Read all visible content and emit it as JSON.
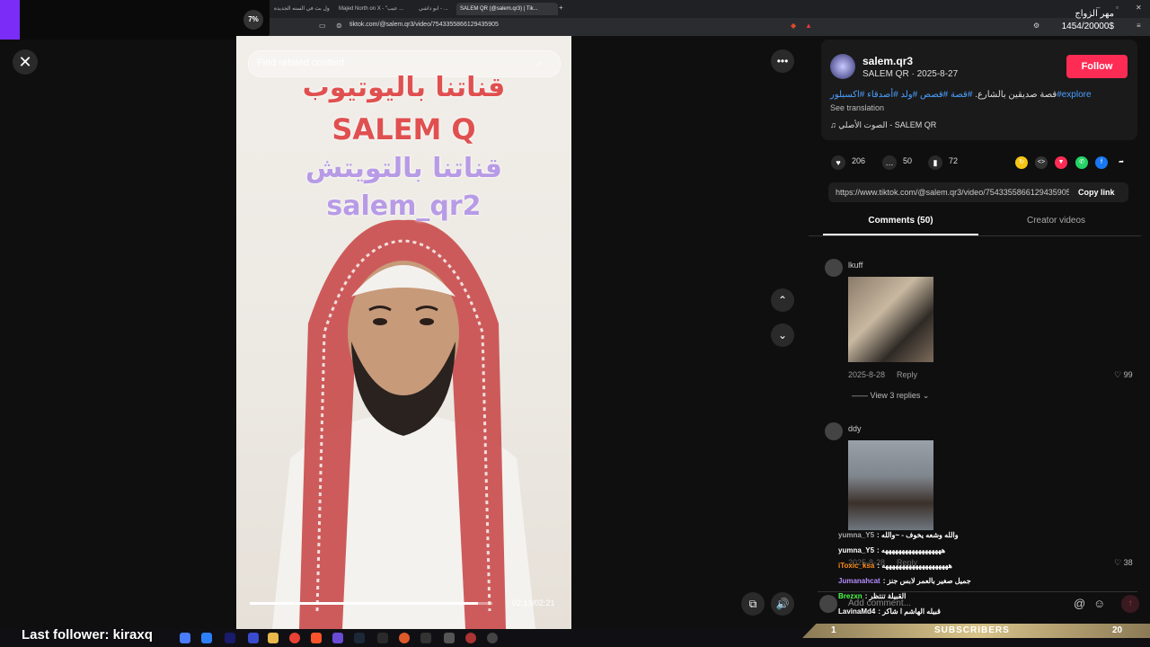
{
  "browser": {
    "tabs": [
      {
        "label": "اول بث في السنه الجديدة"
      },
      {
        "label": "Majed North on X - \"عيب ..."
      },
      {
        "label": "ابو داشي - ..."
      },
      {
        "label": "SALEM QR (@salem.qr3) | Tik..."
      }
    ],
    "url": "tiktok.com/@salem.qr3/video/7543355866129435905"
  },
  "donation": {
    "title": "مهر الزواج",
    "amount": "1454/20000$",
    "percent": "7%",
    "progress": 0.07,
    "accent": "#7b2cf6"
  },
  "video": {
    "search_placeholder": "Find related content",
    "text_lines": [
      "قناتنا باليوتيوب",
      "SALEM Q",
      "قناتنا بالتويتش",
      "salem_qr2"
    ],
    "time": "02:13/02:21",
    "progress": 0.94
  },
  "post": {
    "username": "salem.qr3",
    "display_line": "SALEM QR · 2025-8-27",
    "follow_label": "Follow",
    "description": "قصة صديقين بالشارع. ",
    "hashtags": "#قصة #قصص #ولد #أصدقاء #اكسبلور#explore",
    "see_translation": "See translation",
    "music": "الصوت الأصلي - SALEM QR",
    "likes": "206",
    "comments": "50",
    "saves": "72",
    "link": "https://www.tiktok.com/@salem.qr3/video/7543355866129435905",
    "copy_link_label": "Copy link",
    "brand_color": "#fe2c55"
  },
  "tabs": {
    "comments": "Comments (50)",
    "creator": "Creator videos"
  },
  "comments": [
    {
      "user": "lkuff",
      "date": "2025-8-28",
      "reply": "Reply",
      "likes": "99",
      "view_replies": "View 3 replies"
    },
    {
      "user": "ddy",
      "date": "2025-8-28",
      "reply": "Reply",
      "likes": "38"
    }
  ],
  "chat": [
    {
      "user": "yumna_Y5",
      "msg": "والله وشعه يخوف - ~والله",
      "color": "#aaaaaa"
    },
    {
      "user": "yumna_Y5",
      "msg": "ههههههههههههههههههه",
      "color": "#ffffff"
    },
    {
      "user": "iToxic_ksa",
      "msg": "ههههههههههههههههههههه",
      "color": "#ff8c1a"
    },
    {
      "user": "Jumanahcat",
      "msg": "جميل صغير بالعمر لابس جنز",
      "color": "#b48cff"
    },
    {
      "user": "Brezxn",
      "msg": "القبيلة تنتظر",
      "color": "#4cff4c"
    },
    {
      "user": "LavinaMd4",
      "msg": "قبيله الهاشم ا شاكر",
      "color": "#ffffff"
    }
  ],
  "add_comment_placeholder": "Add comment...",
  "overlay": {
    "last_follower": "Last follower: kiraxq",
    "sub_bar_label": "SUBSCRIBERS",
    "sub_bar_left": "1",
    "sub_bar_right": "20"
  }
}
